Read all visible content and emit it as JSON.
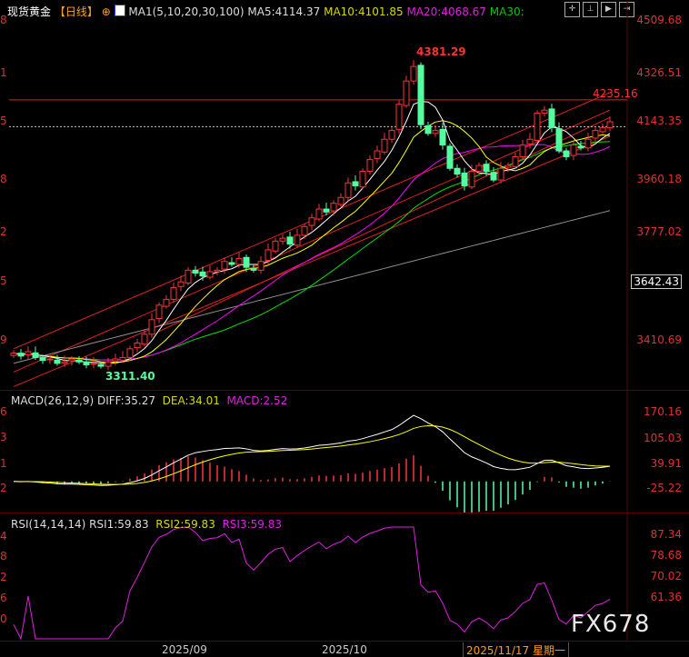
{
  "header": {
    "title": "现货黄金",
    "period": "【日线】",
    "ma_label": "MA1(5,10,20,30,100)",
    "ma5": "MA5:4114.37",
    "ma10": "MA10:4101.85",
    "ma20": "MA20:4068.67",
    "ma30": "MA30:"
  },
  "toolbar": [
    "crosshair",
    "fit",
    "play",
    "exit"
  ],
  "price_axis": [
    "4509.68",
    "4326.51",
    "4143.35",
    "3960.18",
    "3777.02",
    "3642.43",
    "3410.69"
  ],
  "price_left": [
    "8",
    "1",
    "5",
    "8",
    "2",
    "5",
    "9"
  ],
  "annotations": {
    "high": "4381.29",
    "low": "3311.40",
    "level": "4235.16"
  },
  "macd": {
    "label": "MACD(26,12,9)",
    "diff": "DIFF:35.27",
    "dea": "DEA:34.01",
    "macd": "MACD:2.52",
    "axis": [
      "170.16",
      "105.03",
      "39.91",
      "-25.22"
    ],
    "left": [
      "6",
      "3",
      "1",
      "2"
    ]
  },
  "rsi": {
    "label": "RSI(14,14,14)",
    "rsi1": "RSI1:59.83",
    "rsi2": "RSI2:59.83",
    "rsi3": "RSI3:59.83",
    "axis": [
      "87.34",
      "78.68",
      "70.02",
      "61.36"
    ],
    "left": [
      "4",
      "8",
      "2",
      "6",
      "0"
    ]
  },
  "dates": [
    "2025/09",
    "2025/10"
  ],
  "cursor_date": "2025/11/17 星期一",
  "watermark": "FX678",
  "colors": {
    "up": "#ff3232",
    "down": "#54ffa0",
    "ma5": "#ffffff",
    "ma10": "#ffff00",
    "ma20": "#ff00ff",
    "ma30": "#00e000",
    "ma100": "#909090"
  },
  "chart_data": {
    "type": "candlestick",
    "closes": [
      3365,
      3355,
      3370,
      3350,
      3340,
      3345,
      3330,
      3335,
      3345,
      3335,
      3325,
      3330,
      3320,
      3335,
      3345,
      3350,
      3380,
      3400,
      3430,
      3480,
      3530,
      3550,
      3590,
      3610,
      3650,
      3640,
      3630,
      3645,
      3650,
      3680,
      3670,
      3690,
      3660,
      3650,
      3680,
      3720,
      3750,
      3760,
      3740,
      3770,
      3800,
      3830,
      3860,
      3850,
      3880,
      3900,
      3950,
      3940,
      3990,
      4030,
      4060,
      4100,
      4130,
      4220,
      4300,
      4350,
      4150,
      4120,
      4130,
      4080,
      4000,
      3980,
      3940,
      3990,
      4010,
      3990,
      3960,
      4000,
      4010,
      4040,
      4080,
      4100,
      4190,
      4200,
      4140,
      4060,
      4040,
      4080,
      4070,
      4100,
      4130,
      4140,
      4160
    ],
    "ylim": [
      3410.69,
      4509.68
    ],
    "hlines": [
      4235.16,
      4143.35
    ],
    "trendlines": [
      [
        0,
        3300,
        82,
        4200
      ],
      [
        0,
        3380,
        82,
        4260
      ],
      [
        0,
        3250,
        82,
        4110
      ],
      [
        20,
        3440,
        82,
        4175
      ]
    ]
  }
}
